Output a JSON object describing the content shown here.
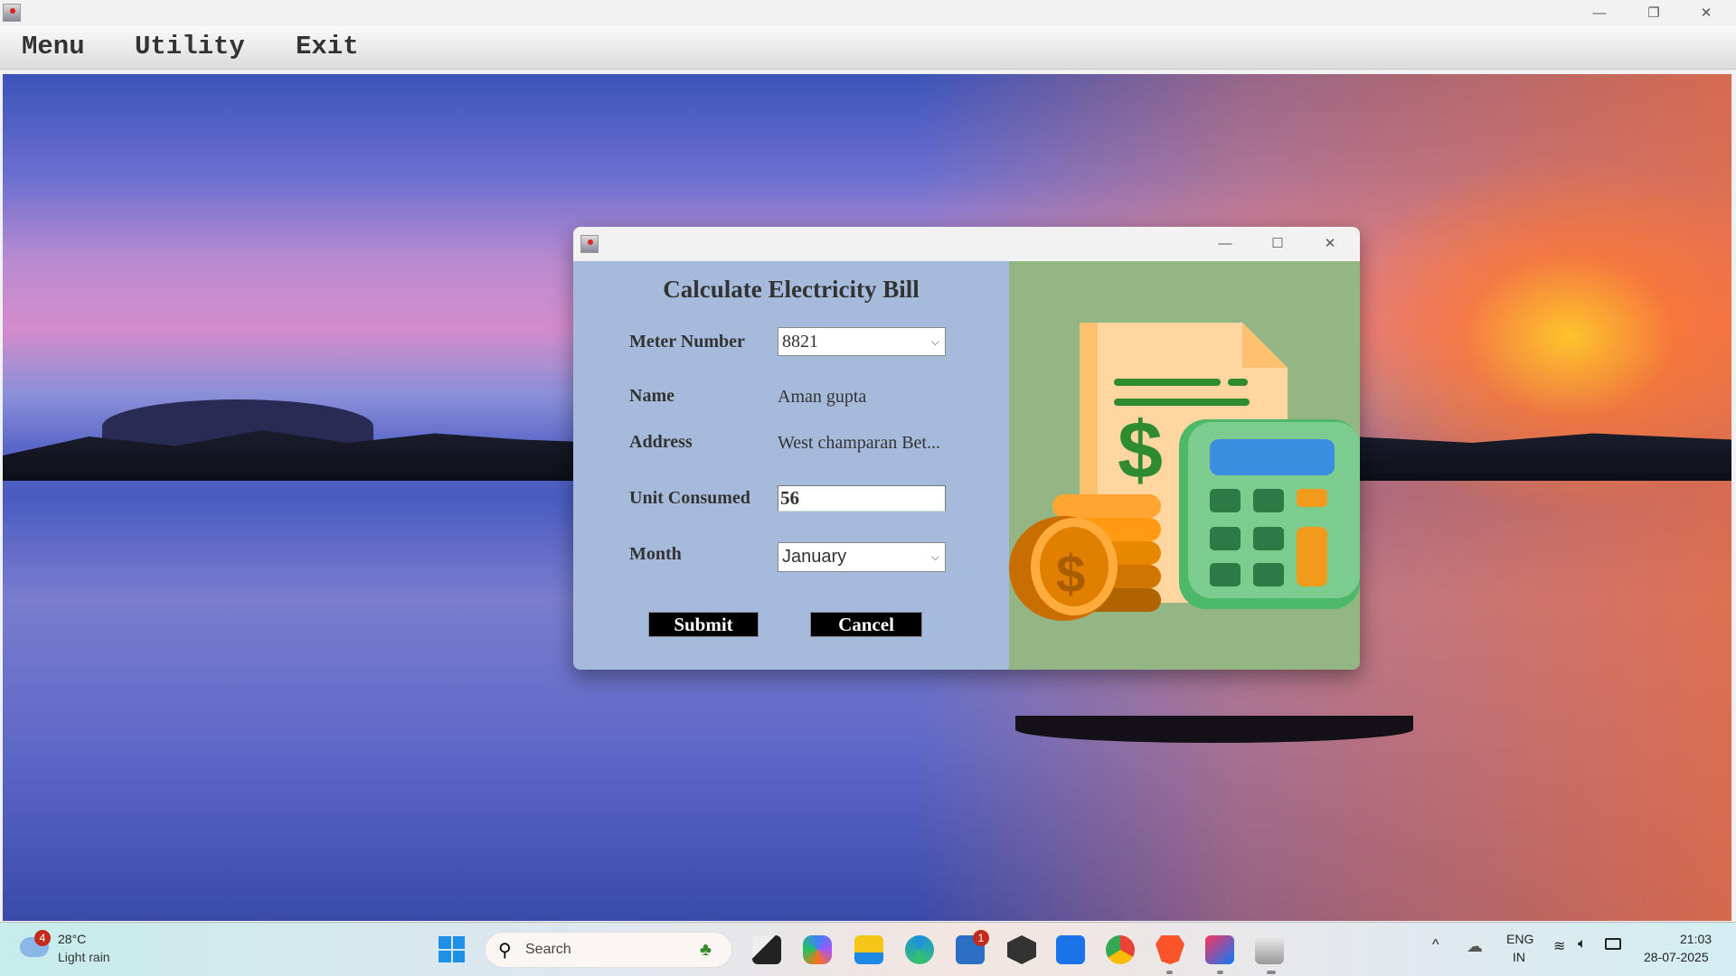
{
  "window": {
    "minimize": "—",
    "restore": "❐",
    "close": "✕"
  },
  "menubar": {
    "items": [
      "Menu",
      "Utility",
      "Exit"
    ]
  },
  "dialog": {
    "controls": {
      "minimize": "—",
      "maximize": "☐",
      "close": "✕"
    },
    "heading": "Calculate Electricity Bill",
    "meter_label": "Meter Number",
    "meter_value": "8821",
    "name_label": "Name",
    "name_value": "Aman gupta",
    "address_label": "Address",
    "address_value": "West champaran Bet...",
    "units_label": "Unit Consumed",
    "units_value": "56",
    "month_label": "Month",
    "month_value": "January",
    "submit": "Submit",
    "cancel": "Cancel"
  },
  "taskbar": {
    "weather": {
      "badge": "4",
      "temp": "28°C",
      "condition": "Light rain"
    },
    "search_placeholder": "Search",
    "store_badge": "1",
    "tray": {
      "lang1": "ENG",
      "lang2": "IN",
      "time": "21:03",
      "date": "28-07-2025"
    },
    "apps": [
      "task-view",
      "copilot",
      "file-explorer",
      "edge",
      "store",
      "app-dark",
      "app-blue",
      "chrome",
      "brave",
      "intellij",
      "java"
    ]
  },
  "colors": {
    "form_bg": "#a6bbdc",
    "image_bg": "#94b684",
    "button_bg": "#000000"
  }
}
